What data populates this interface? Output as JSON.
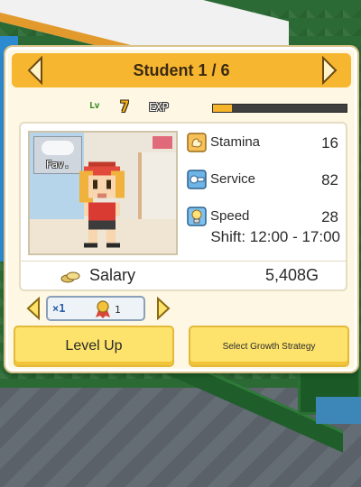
{
  "header": {
    "title": "Student 1 / 6",
    "prev_icon": "chevron-left-icon",
    "next_icon": "chevron-right-icon"
  },
  "level": {
    "lv_label": "Lv",
    "value": "7",
    "exp_label": "EXP",
    "exp_progress": 0.14
  },
  "portrait": {
    "fav_label": "Fav."
  },
  "stats": [
    {
      "label": "Stamina",
      "value": "16",
      "icon": "stamina-icon"
    },
    {
      "label": "Service",
      "value": "82",
      "icon": "service-icon"
    },
    {
      "label": "Speed",
      "value": "28",
      "icon": "speed-icon"
    }
  ],
  "shift": "Shift: 12:00 - 17:00",
  "salary": {
    "label": "Salary",
    "value": "5,408G"
  },
  "items": {
    "x_label": "×1",
    "medal_count": "1"
  },
  "buttons": {
    "level_up": "Level Up",
    "growth_strategy": "Select Growth Strategy"
  },
  "colors": {
    "title_bar": "#f7b630",
    "button": "#fde36b",
    "exp_fill": "#f5b42a"
  }
}
